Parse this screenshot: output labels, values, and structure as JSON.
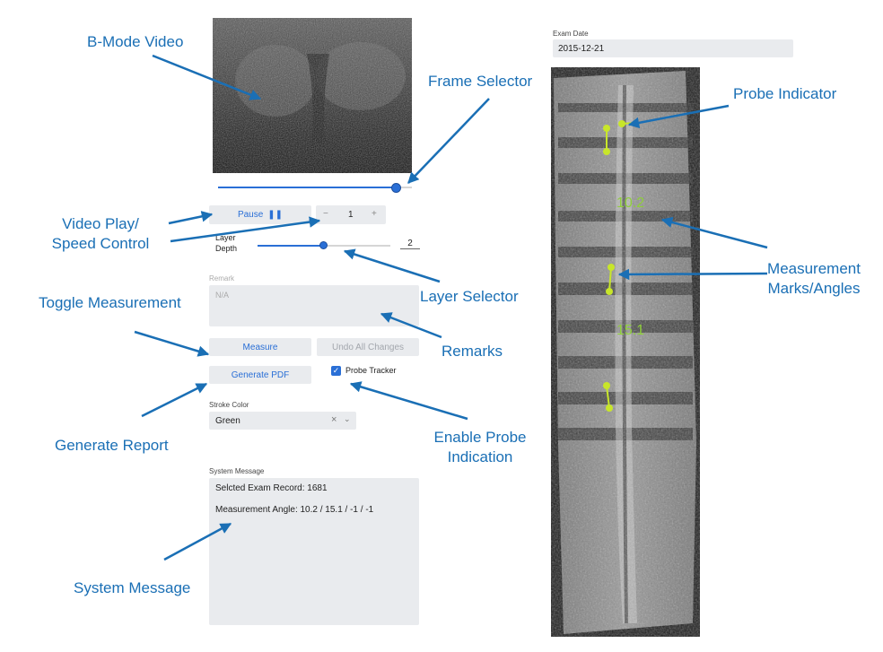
{
  "exam": {
    "date_label": "Exam Date",
    "date_value": "2015-12-21"
  },
  "controls": {
    "pause_label": "Pause",
    "pause_icon": "pause-icon",
    "stepper": {
      "minus": "−",
      "value": "1",
      "plus": "+"
    },
    "layer_label_line1": "Layer",
    "layer_label_line2": "Depth",
    "layer_value": "2",
    "layer_level_fraction": 0.5,
    "frame_level_fraction": 0.92,
    "remark_label": "Remark",
    "remark_placeholder": "N/A",
    "measure_label": "Measure",
    "undo_label": "Undo All Changes",
    "generate_pdf_label": "Generate PDF",
    "probe_tracker_label": "Probe Tracker",
    "probe_tracker_checked": true,
    "stroke_color_label": "Stroke Color",
    "stroke_color_value": "Green",
    "system_message_label": "System Message",
    "system_message_line1": "Selcted Exam Record: 1681",
    "system_message_line2": "Measurement Angle: 10.2 / 15.1 / -1 / -1"
  },
  "image_measurements": {
    "angle1": "10.2",
    "angle2": "15.1"
  },
  "annotations": {
    "bmode_video": "B-Mode Video",
    "frame_selector": "Frame Selector",
    "probe_indicator": "Probe Indicator",
    "video_play_line1": "Video Play/",
    "video_play_line2": "Speed Control",
    "layer_selector": "Layer Selector",
    "measurement_marks_line1": "Measurement",
    "measurement_marks_line2": "Marks/Angles",
    "toggle_measurement": "Toggle Measurement",
    "remarks": "Remarks",
    "generate_report": "Generate Report",
    "enable_probe_line1": "Enable Probe",
    "enable_probe_line2": "Indication",
    "system_message": "System Message"
  },
  "colors": {
    "annotation_blue": "#1a6fb5",
    "accent_blue": "#2a6fd6",
    "marker_green": "#c8e62a",
    "measure_text_green": "#8fcf3a"
  }
}
